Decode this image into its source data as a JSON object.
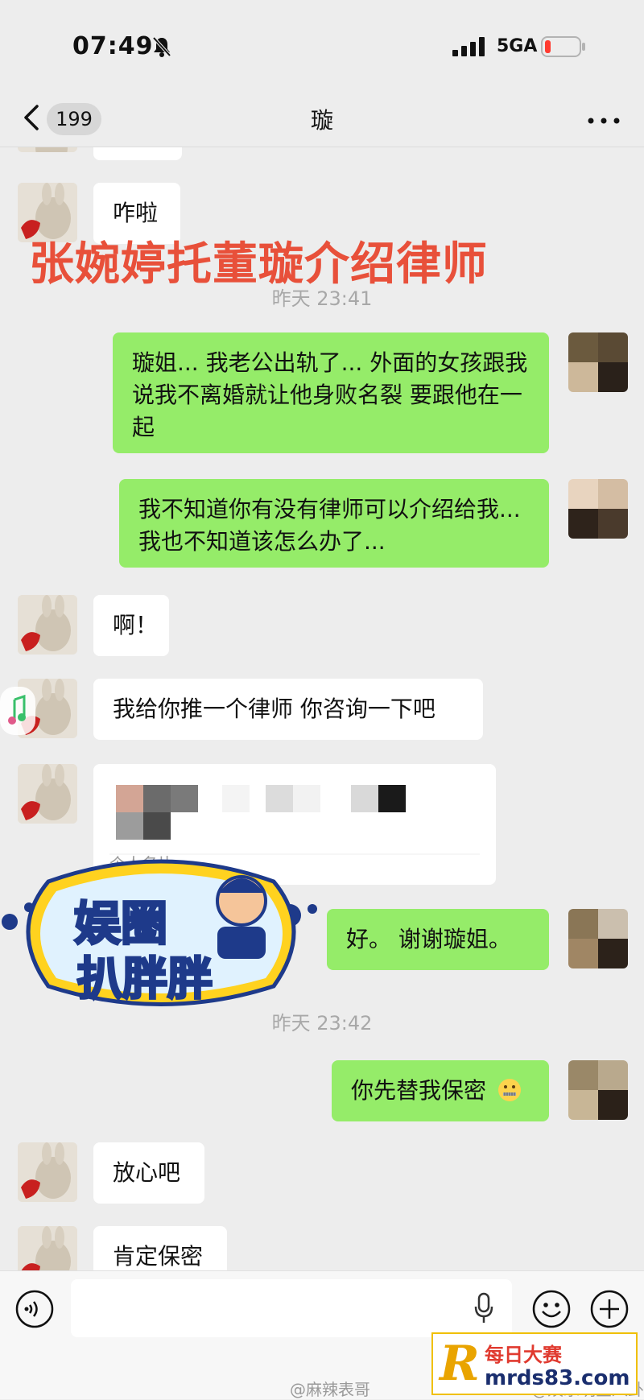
{
  "status": {
    "time": "07:49",
    "network": "5GA"
  },
  "nav": {
    "back_count": "199",
    "title": "璇"
  },
  "overlay": {
    "title": "张婉婷托董璇介绍律师"
  },
  "messages": [
    {
      "side": "in",
      "text": "咋啦"
    },
    {
      "side": "time",
      "text": "昨天 23:41"
    },
    {
      "side": "out",
      "text": "璇姐... 我老公出轨了... 外面的女孩跟我说我不离婚就让他身败名裂 要跟他在一起"
    },
    {
      "side": "out",
      "text": "我不知道你有没有律师可以介绍给我... 我也不知道该怎么办了..."
    },
    {
      "side": "in",
      "text": "啊！"
    },
    {
      "side": "in",
      "text": "我给你推一个律师 你咨询一下吧"
    },
    {
      "side": "in_card",
      "text": "个人名片"
    },
    {
      "side": "out",
      "text": "好。 谢谢璇姐。"
    },
    {
      "side": "time",
      "text": "昨天 23:42"
    },
    {
      "side": "out",
      "text": "你先替我保密"
    },
    {
      "side": "in",
      "text": "放心吧"
    },
    {
      "side": "in",
      "text": "肯定保密"
    }
  ],
  "sticker": {
    "line1": "娱圈",
    "line2": "扒胖胖"
  },
  "watermarks": {
    "left": "@麻辣表哥",
    "right": "@娱乐明星八卦"
  },
  "logo": {
    "r": "R",
    "line1": "每日大赛",
    "line2": "mrds83.com"
  },
  "colors": {
    "outgoing": "#95ec69",
    "incoming": "#ffffff",
    "overlay": "#e8503a"
  },
  "icons": [
    "voice-icon",
    "microphone-icon",
    "emoji-icon",
    "plus-icon",
    "mute-bell-icon",
    "signal-icon",
    "battery-icon",
    "back-chevron-icon",
    "more-icon"
  ]
}
